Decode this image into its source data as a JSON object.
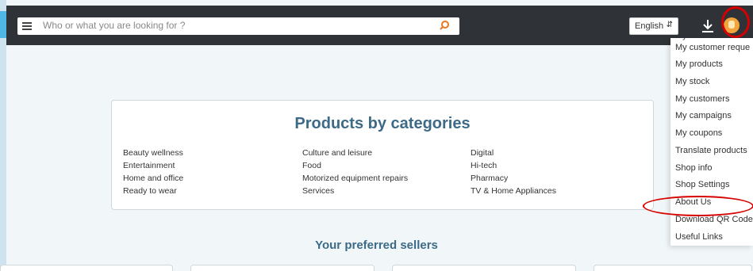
{
  "search": {
    "placeholder": "Who or what you are looking for ?"
  },
  "language": {
    "selected": "English"
  },
  "categories": {
    "title": "Products by categories",
    "columns": [
      [
        "Beauty wellness",
        "Entertainment",
        "Home and office",
        "Ready to wear"
      ],
      [
        "Culture and leisure",
        "Food",
        "Motorized equipment repairs",
        "Services"
      ],
      [
        "Digital",
        "Hi-tech",
        "Pharmacy",
        "TV & Home Appliances"
      ]
    ]
  },
  "sellers": {
    "title": "Your preferred sellers"
  },
  "user_menu": {
    "items": [
      "My customer reque",
      "My products",
      "My stock",
      "My customers",
      "My campaigns",
      "My coupons",
      "Translate products",
      "Shop info",
      "Shop Settings",
      "About Us",
      "Download QR Code",
      "Useful Links"
    ]
  },
  "icons": {
    "menu": "hamburger-menu-icon",
    "search": "search-icon",
    "download": "download-icon",
    "avatar": "user-avatar-icon"
  },
  "colors": {
    "topbar": "#2f3338",
    "accent_title": "#3d6a86",
    "search_icon": "#e87722",
    "highlight_ring": "#d60000",
    "avatar": "#f2a33c"
  }
}
